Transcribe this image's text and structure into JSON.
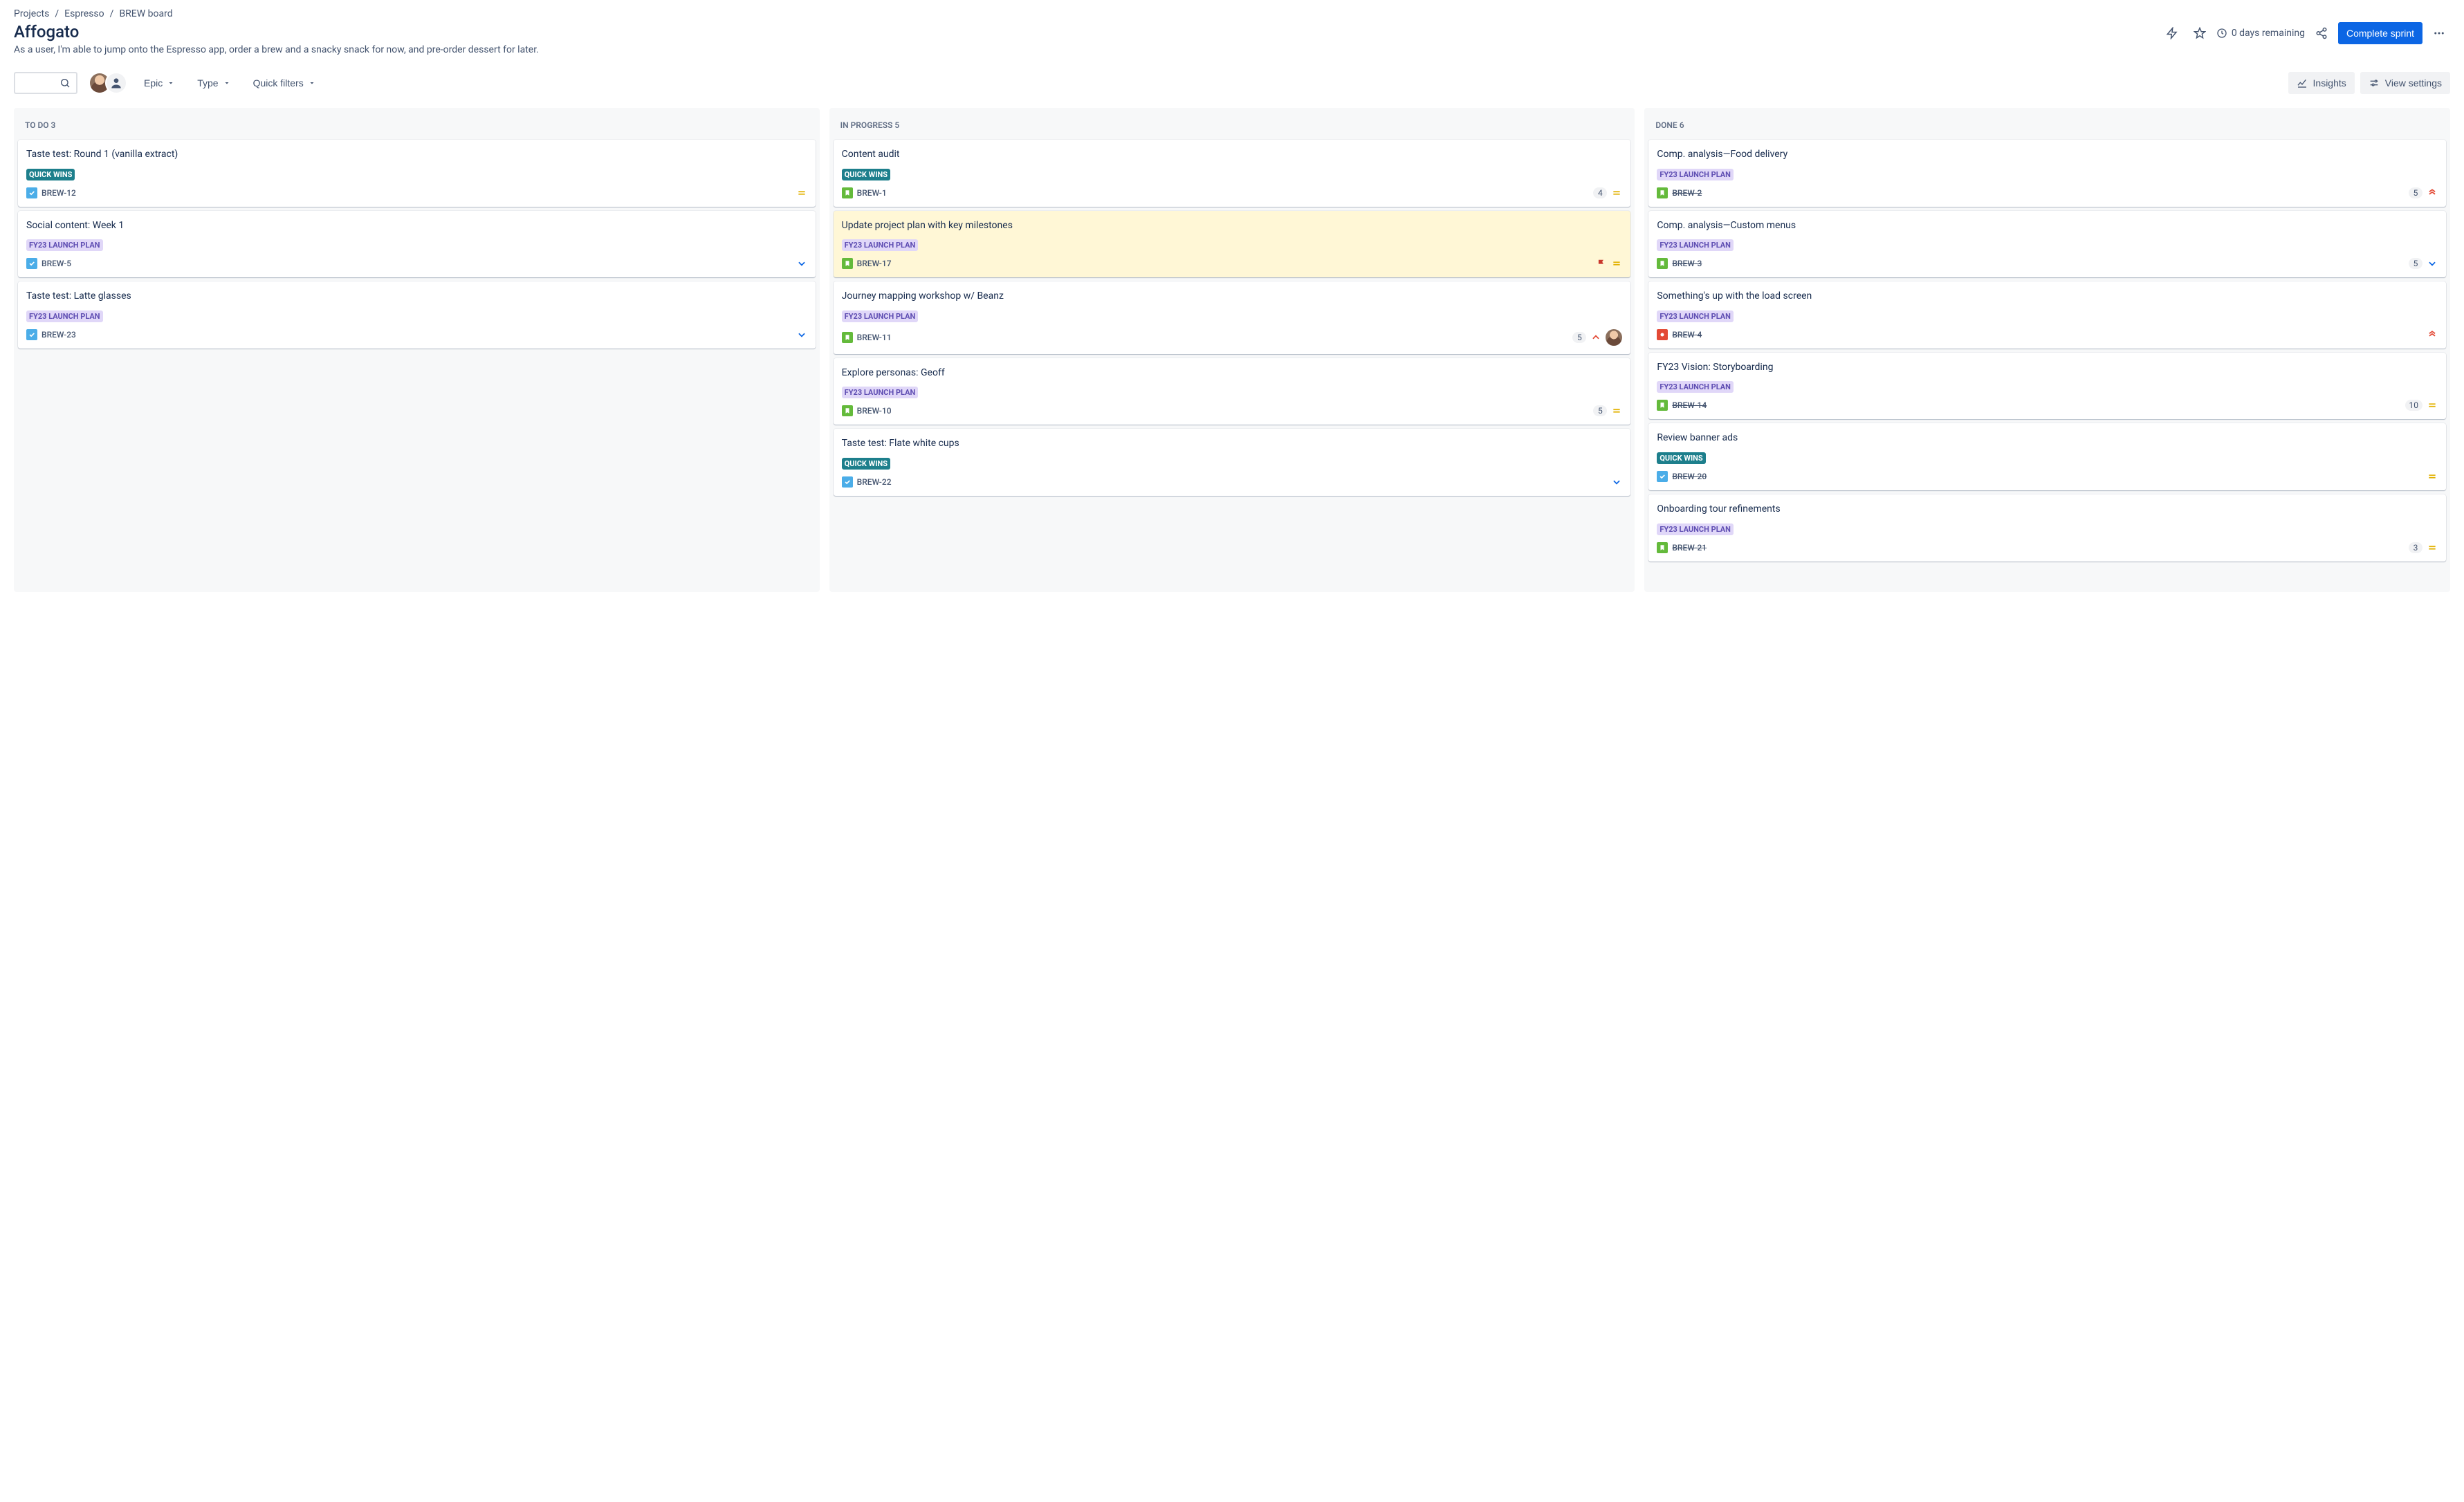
{
  "breadcrumb": {
    "projects": "Projects",
    "project": "Espresso",
    "board": "BREW board"
  },
  "page": {
    "title": "Affogato",
    "subtitle": "As a user, I'm able to jump onto the Espresso app, order a brew and a snacky snack for now, and pre-order dessert for later.",
    "time_remaining": "0 days remaining",
    "complete_sprint": "Complete sprint"
  },
  "toolbar": {
    "epic": "Epic",
    "type": "Type",
    "quick_filters": "Quick filters",
    "insights": "Insights",
    "view_settings": "View settings"
  },
  "columns": {
    "todo": {
      "name": "TO DO",
      "count": "3"
    },
    "inprogress": {
      "name": "IN PROGRESS",
      "count": "5"
    },
    "done": {
      "name": "DONE",
      "count": "6"
    }
  },
  "labels": {
    "quick_wins": "QUICK WINS",
    "fy23": "FY23 LAUNCH PLAN"
  },
  "cards": {
    "todo": [
      {
        "title": "Taste test: Round 1 (vanilla extract)",
        "label": "quick_wins",
        "key": "BREW-12",
        "type": "task",
        "priority": "medium"
      },
      {
        "title": "Social content: Week 1",
        "label": "fy23",
        "key": "BREW-5",
        "type": "task",
        "priority": "low"
      },
      {
        "title": "Taste test: Latte glasses",
        "label": "fy23",
        "key": "BREW-23",
        "type": "task",
        "priority": "low"
      }
    ],
    "inprogress": [
      {
        "title": "Content audit",
        "label": "quick_wins",
        "key": "BREW-1",
        "type": "story",
        "estimate": "4",
        "priority": "medium"
      },
      {
        "title": "Update project plan with key milestones",
        "label": "fy23",
        "key": "BREW-17",
        "type": "story",
        "flagged": true,
        "priority": "medium"
      },
      {
        "title": "Journey mapping workshop w/ Beanz",
        "label": "fy23",
        "key": "BREW-11",
        "type": "story",
        "estimate": "5",
        "priority": "high",
        "assignee": true
      },
      {
        "title": "Explore personas: Geoff",
        "label": "fy23",
        "key": "BREW-10",
        "type": "story",
        "estimate": "5",
        "priority": "medium"
      },
      {
        "title": "Taste test: Flate white cups",
        "label": "quick_wins",
        "key": "BREW-22",
        "type": "task",
        "priority": "low"
      }
    ],
    "done": [
      {
        "title": "Comp. analysis—Food delivery",
        "label": "fy23",
        "key": "BREW-2",
        "type": "story",
        "done": true,
        "estimate": "5",
        "priority": "highest"
      },
      {
        "title": "Comp. analysis—Custom menus",
        "label": "fy23",
        "key": "BREW-3",
        "type": "story",
        "done": true,
        "estimate": "5",
        "priority": "low"
      },
      {
        "title": "Something's up with the load screen",
        "label": "fy23",
        "key": "BREW-4",
        "type": "bug",
        "done": true,
        "priority": "highest"
      },
      {
        "title": "FY23 Vision: Storyboarding",
        "label": "fy23",
        "key": "BREW-14",
        "type": "story",
        "done": true,
        "estimate": "10",
        "priority": "medium"
      },
      {
        "title": "Review banner ads",
        "label": "quick_wins",
        "key": "BREW-20",
        "type": "task",
        "done": true,
        "priority": "medium"
      },
      {
        "title": "Onboarding tour refinements",
        "label": "fy23",
        "key": "BREW-21",
        "type": "story",
        "done": true,
        "estimate": "3",
        "priority": "medium"
      }
    ]
  }
}
